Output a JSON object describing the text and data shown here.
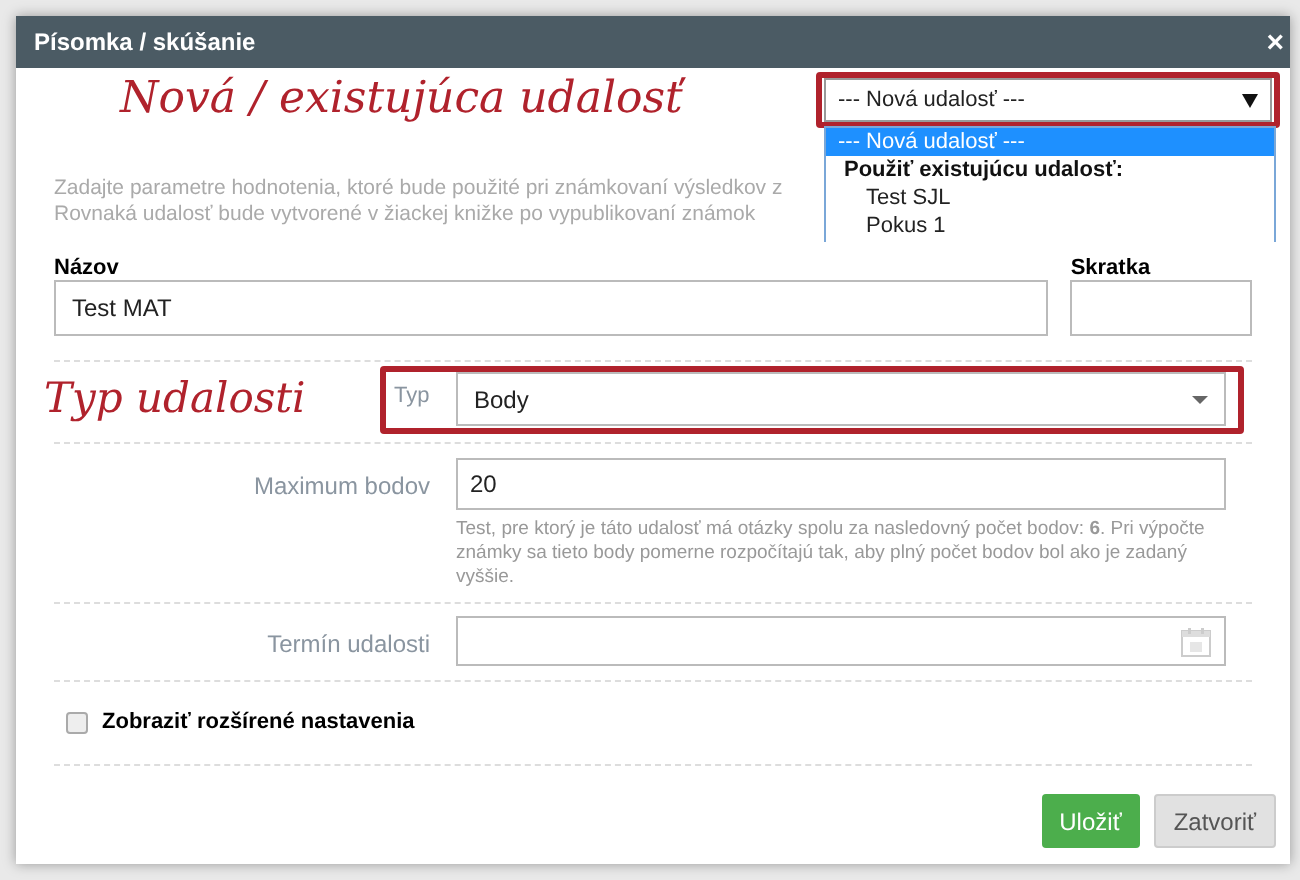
{
  "dialog": {
    "title": "Písomka / skúšanie",
    "close": "×"
  },
  "annotations": [
    "Nová / existujúca udalosť",
    "Typ udalosti"
  ],
  "event_select": {
    "value": "--- Nová udalosť ---",
    "expanded": true,
    "options": [
      {
        "kind": "option",
        "label": "--- Nová udalosť ---",
        "selected": true
      },
      {
        "kind": "group",
        "label": "Použiť existujúcu udalosť:"
      },
      {
        "kind": "option",
        "label": "Test SJL",
        "selected": false
      },
      {
        "kind": "option",
        "label": "Pokus 1",
        "selected": false
      }
    ]
  },
  "description_lines": [
    "Zadajte parametre hodnotenia, ktoré bude použité pri známkovaní výsledkov z",
    "Rovnaká udalosť bude vytvorené v žiackej knižke po vypublikovaní známok"
  ],
  "name_field": {
    "label": "Názov",
    "value": "Test MAT"
  },
  "short_field": {
    "label": "Skratka"
  },
  "type_field": {
    "label": "Typ",
    "value": "Body"
  },
  "max_points": {
    "label": "Maximum bodov",
    "value": "20",
    "help": "Test, pre ktorý je táto udalosť má otázky spolu za nasledovný počet bodov: **6**. Pri výpočte známky sa tieto body pomerne rozpočítajú tak, aby plný počet bodov bol ako je zadaný vyššie."
  },
  "date_field": {
    "label": "Termín udalosti"
  },
  "advanced": {
    "label": "Zobraziť rozšírené nastavenia",
    "checked": false
  },
  "buttons": [
    {
      "kind": "primary",
      "label": "Uložiť"
    },
    {
      "kind": "secondary",
      "label": "Zatvoriť"
    }
  ]
}
